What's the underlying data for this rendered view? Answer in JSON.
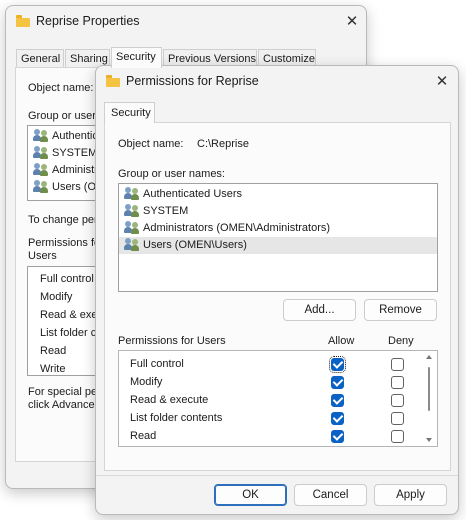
{
  "back_window": {
    "title": "Reprise Properties",
    "tabs": [
      "General",
      "Sharing",
      "Security",
      "Previous Versions",
      "Customize"
    ],
    "object_label": "Object name:",
    "group_label": "Group or user n",
    "users": [
      "Authenticat",
      "SYSTEM",
      "Administra",
      "Users (OME"
    ],
    "change_text": "To change per",
    "permissions_label": "Permissions for",
    "permissions_label2": "Users",
    "permissions": [
      "Full control",
      "Modify",
      "Read & execut",
      "List folder co",
      "Read",
      "Write"
    ],
    "special_text": "For special per",
    "special_text2": "click Advance"
  },
  "dialog": {
    "title": "Permissions for Reprise",
    "tab": "Security",
    "object_label": "Object name:",
    "object_value": "C:\\Reprise",
    "group_label": "Group or user names:",
    "users": [
      "Authenticated Users",
      "SYSTEM",
      "Administrators (OMEN\\Administrators)",
      "Users (OMEN\\Users)"
    ],
    "add_button": "Add...",
    "remove_button": "Remove",
    "permissions_header": "Permissions for Users",
    "allow_header": "Allow",
    "deny_header": "Deny",
    "permissions": [
      {
        "name": "Full control",
        "allow": true,
        "deny": false
      },
      {
        "name": "Modify",
        "allow": true,
        "deny": false
      },
      {
        "name": "Read & execute",
        "allow": true,
        "deny": false
      },
      {
        "name": "List folder contents",
        "allow": true,
        "deny": false
      },
      {
        "name": "Read",
        "allow": true,
        "deny": false
      }
    ],
    "ok_button": "OK",
    "cancel_button": "Cancel",
    "apply_button": "Apply"
  }
}
